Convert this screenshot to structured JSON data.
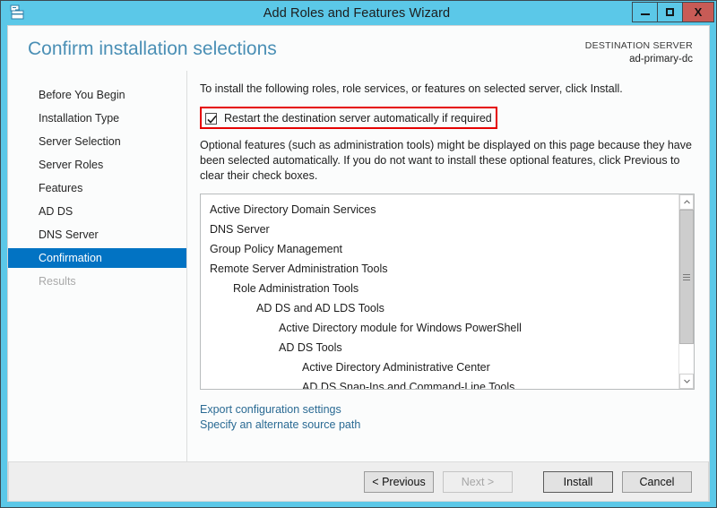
{
  "window": {
    "title": "Add Roles and Features Wizard",
    "icon": "server-wizard-icon",
    "accent_color": "#5bc8e8",
    "controls": {
      "minimize": "minimize-icon",
      "maximize": "maximize-icon",
      "close": "X"
    }
  },
  "header": {
    "page_title": "Confirm installation selections",
    "destination_label": "DESTINATION SERVER",
    "destination_value": "ad-primary-dc"
  },
  "sidebar": {
    "items": [
      {
        "label": "Before You Begin",
        "state": "normal"
      },
      {
        "label": "Installation Type",
        "state": "normal"
      },
      {
        "label": "Server Selection",
        "state": "normal"
      },
      {
        "label": "Server Roles",
        "state": "normal"
      },
      {
        "label": "Features",
        "state": "normal"
      },
      {
        "label": "AD DS",
        "state": "normal"
      },
      {
        "label": "DNS Server",
        "state": "normal"
      },
      {
        "label": "Confirmation",
        "state": "active"
      },
      {
        "label": "Results",
        "state": "disabled"
      }
    ]
  },
  "content": {
    "intro_text": "To install the following roles, role services, or features on selected server, click Install.",
    "restart_checkbox": {
      "label": "Restart the destination server automatically if required",
      "checked": true,
      "highlight_color": "#e50000"
    },
    "optional_text": "Optional features (such as administration tools) might be displayed on this page because they have been selected automatically. If you do not want to install these optional features, click Previous to clear their check boxes.",
    "feature_list": [
      {
        "label": "Active Directory Domain Services",
        "indent": 0
      },
      {
        "label": "DNS Server",
        "indent": 0
      },
      {
        "label": "Group Policy Management",
        "indent": 0
      },
      {
        "label": "Remote Server Administration Tools",
        "indent": 0
      },
      {
        "label": "Role Administration Tools",
        "indent": 1
      },
      {
        "label": "AD DS and AD LDS Tools",
        "indent": 2
      },
      {
        "label": "Active Directory module for Windows PowerShell",
        "indent": 3
      },
      {
        "label": "AD DS Tools",
        "indent": 3
      },
      {
        "label": "Active Directory Administrative Center",
        "indent": 4
      },
      {
        "label": "AD DS Snap-Ins and Command-Line Tools",
        "indent": 4
      }
    ],
    "links": [
      "Export configuration settings",
      "Specify an alternate source path"
    ]
  },
  "footer": {
    "buttons": [
      {
        "label": "< Previous",
        "state": "normal"
      },
      {
        "label": "Next >",
        "state": "disabled"
      },
      {
        "label": "Install",
        "state": "default"
      },
      {
        "label": "Cancel",
        "state": "normal"
      }
    ]
  }
}
